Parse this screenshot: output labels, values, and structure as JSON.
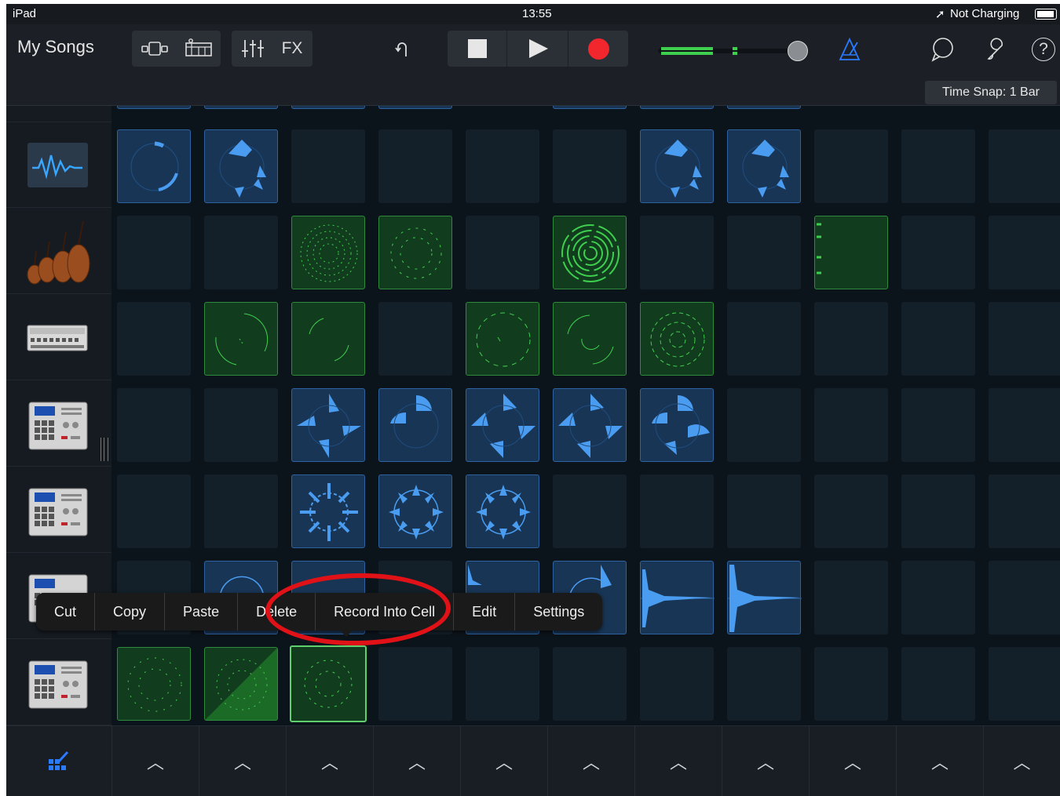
{
  "statusbar": {
    "device": "iPad",
    "time": "13:55",
    "battery_text": "Not Charging"
  },
  "toolbar": {
    "my_songs": "My Songs",
    "fx_label": "FX",
    "time_snap": "Time Snap: 1 Bar",
    "icons": [
      "grid-view-icon",
      "track-view-icon",
      "mixer-icon",
      "undo-icon",
      "stop-icon",
      "play-icon",
      "record-icon",
      "master-volume-icon",
      "metronome-icon",
      "loop-browser-icon",
      "settings-wrench-icon",
      "help-icon"
    ],
    "accent_green": "#3fcf4f",
    "record_red": "#f2262d",
    "metronome_blue": "#2a7bff"
  },
  "sidebar": {
    "tracks": [
      "alchemy-synth",
      "strings",
      "drum-machine",
      "beat-sequencer",
      "beat-sequencer",
      "beat-sequencer",
      "beat-sequencer"
    ]
  },
  "grid": {
    "rows": [
      [
        "blue",
        "blue",
        "empty",
        "empty",
        "empty",
        "empty",
        "blue",
        "blue",
        "empty",
        "empty",
        "empty"
      ],
      [
        "empty",
        "empty",
        "green",
        "green",
        "empty",
        "green",
        "empty",
        "empty",
        "green",
        "empty",
        "empty"
      ],
      [
        "empty",
        "green",
        "green",
        "empty",
        "green",
        "green",
        "green",
        "empty",
        "empty",
        "empty",
        "empty"
      ],
      [
        "empty",
        "empty",
        "blue",
        "blue",
        "blue",
        "blue",
        "blue",
        "empty",
        "empty",
        "empty",
        "empty"
      ],
      [
        "empty",
        "empty",
        "blue",
        "blue",
        "blue",
        "empty",
        "empty",
        "empty",
        "empty",
        "empty",
        "empty"
      ],
      [
        "empty",
        "blue",
        "blue",
        "empty",
        "blue",
        "blue",
        "blue",
        "blue",
        "empty",
        "empty",
        "empty"
      ],
      [
        "green",
        "green-playing",
        "green-selected",
        "empty",
        "empty",
        "empty",
        "empty",
        "empty",
        "empty",
        "empty",
        "empty"
      ]
    ]
  },
  "context_menu": {
    "items": [
      "Cut",
      "Copy",
      "Paste",
      "Delete",
      "Record Into Cell",
      "Edit",
      "Settings"
    ],
    "annotation_color": "#e01218"
  },
  "bottombar": {
    "columns": 11,
    "trigger_icon": "chevron-up-icon",
    "edit_icon": "edit-grid-icon"
  }
}
